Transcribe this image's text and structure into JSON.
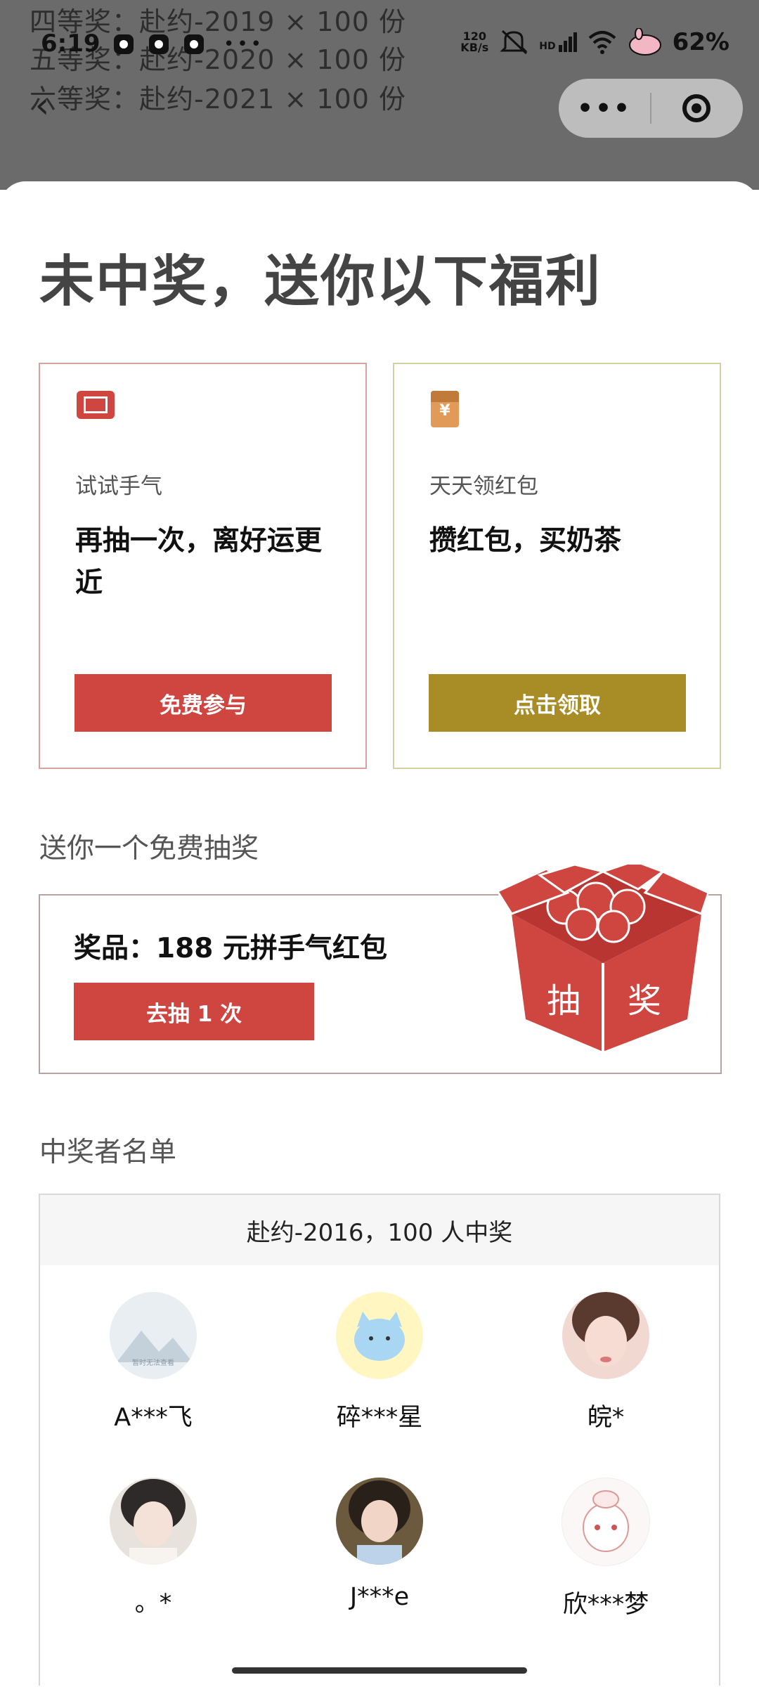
{
  "background_list": {
    "lines": [
      "四等奖：赴约-2019 × 100 份",
      "五等奖：赴约-2020 × 100 份",
      "六等奖：赴约-2021 × 100 份"
    ]
  },
  "status_bar": {
    "time": "6:19",
    "net_speed_value": "120",
    "net_speed_unit": "KB/s",
    "signal_label": "HD",
    "battery": "62%"
  },
  "capsule": {
    "more_label": "•••"
  },
  "headline": "未中奖，送你以下福利",
  "cards": [
    {
      "subtitle": "试试手气",
      "title": "再抽一次，离好运更近",
      "button": "免费参与",
      "icon": "ticket-icon"
    },
    {
      "subtitle": "天天领红包",
      "title": "攒红包，买奶茶",
      "button": "点击领取",
      "icon": "red-envelope-icon",
      "icon_glyph": "¥"
    }
  ],
  "free_draw": {
    "section_title": "送你一个免费抽奖",
    "prize": "奖品：188 元拼手气红包",
    "button": "去抽 1 次",
    "box_text_left": "抽",
    "box_text_right": "奖"
  },
  "winners": {
    "section_title": "中奖者名单",
    "header": "赴约-2016，100 人中奖",
    "people": [
      {
        "name": "A***飞"
      },
      {
        "name": "碎***星"
      },
      {
        "name": "皖*"
      },
      {
        "name": "。*"
      },
      {
        "name": "J***e"
      },
      {
        "name": "欣***梦"
      }
    ],
    "placeholder_text": "暂时无法查看"
  },
  "colors": {
    "accent_red": "#cf4540",
    "accent_olive": "#a88c25",
    "overlay": "#6b6b6b"
  }
}
